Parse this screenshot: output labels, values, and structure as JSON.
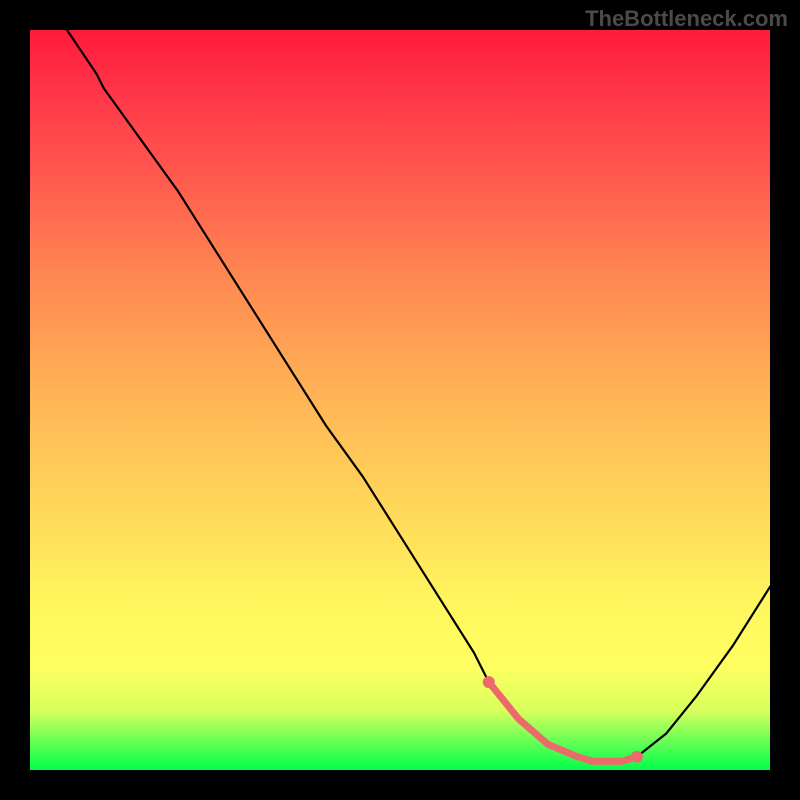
{
  "watermark": "TheBottleneck.com",
  "chart_data": {
    "type": "line",
    "title": "",
    "xlabel": "",
    "ylabel": "",
    "xlim": [
      0,
      100
    ],
    "ylim": [
      0,
      101
    ],
    "x": [
      5,
      9,
      10,
      15,
      20,
      25,
      30,
      35,
      40,
      45,
      50,
      55,
      60,
      62,
      66,
      70,
      74,
      76,
      80,
      82,
      86,
      90,
      95,
      100
    ],
    "values": [
      101,
      95,
      93,
      86,
      79,
      71,
      63,
      55,
      47,
      40,
      32,
      24,
      16,
      12,
      7,
      3.5,
      1.8,
      1.2,
      1.2,
      1.8,
      5,
      10,
      17,
      25
    ],
    "series": [
      {
        "name": "curve",
        "x": [
          5,
          9,
          10,
          15,
          20,
          25,
          30,
          35,
          40,
          45,
          50,
          55,
          60,
          62,
          66,
          70,
          74,
          76,
          80,
          82,
          86,
          90,
          95,
          100
        ],
        "values": [
          101,
          95,
          93,
          86,
          79,
          71,
          63,
          55,
          47,
          40,
          32,
          24,
          16,
          12,
          7,
          3.5,
          1.8,
          1.2,
          1.2,
          1.8,
          5,
          10,
          17,
          25
        ]
      },
      {
        "name": "highlight-segment",
        "x": [
          62,
          66,
          70,
          74,
          76,
          80,
          82
        ],
        "values": [
          12,
          7,
          3.5,
          1.8,
          1.2,
          1.2,
          1.8
        ]
      }
    ],
    "highlight_color": "#ed6a6a",
    "highlight_markers_x": [
      62,
      82
    ],
    "highlight_markers_y": [
      12,
      1.8
    ],
    "gradient_stops": [
      {
        "pos": 0,
        "color": "#ff1a3a"
      },
      {
        "pos": 8,
        "color": "#ff3448"
      },
      {
        "pos": 20,
        "color": "#ff5a4e"
      },
      {
        "pos": 34,
        "color": "#ff8a52"
      },
      {
        "pos": 50,
        "color": "#ffb556"
      },
      {
        "pos": 66,
        "color": "#ffdb5a"
      },
      {
        "pos": 78,
        "color": "#fff75d"
      },
      {
        "pos": 86,
        "color": "#ffff62"
      },
      {
        "pos": 92,
        "color": "#d8ff5c"
      },
      {
        "pos": 96,
        "color": "#6bff56"
      },
      {
        "pos": 100,
        "color": "#00ff4a"
      }
    ]
  }
}
